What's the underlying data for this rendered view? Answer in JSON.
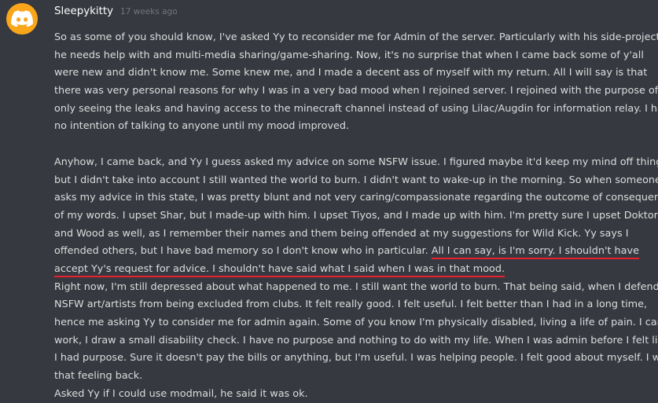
{
  "message": {
    "username": "Sleepykitty",
    "timestamp": "17 weeks ago",
    "avatar": {
      "icon": "discord-logo-icon",
      "background": "#faa61a"
    },
    "paragraphs": [
      {
        "lines": [
          "So as some of you should know, I've asked Yy to reconsider me for Admin of the server. Particularly with his side-projects",
          "he needs help with and multi-media sharing/game-sharing. Now, it's no surprise that when I came back some of y'all",
          "were new and didn't know me. Some knew me, and I made a decent ass of myself with my return. All I will say is that",
          "there was very personal reasons for why I was in a very bad mood when I rejoined server. I rejoined with the purpose of",
          "only seeing the leaks and having access to the minecraft channel instead of using Lilac/Augdin for information relay. I had",
          "no intention of talking to anyone until my mood improved."
        ]
      },
      {
        "lines": [
          "Anyhow, I came back, and Yy I guess asked my advice on some NSFW issue. I figured maybe it'd keep my mind off things,",
          "but I didn't take into account I still wanted the world to burn. I didn't want to wake-up in the morning. So when someone",
          "asks my advice in this state, I was pretty blunt and not very caring/compassionate regarding the outcome of consequence",
          "of my words. I upset Shar, but I made-up with him. I upset Tiyos, and I made up with him. I'm pretty sure I upset Doktor",
          "and Wood as well, as I remember their names and them being offended at my suggestions for Wild Kick. Yy says I"
        ],
        "highlight_lead": "offended others, but I have bad memory so I don't know who in particular. ",
        "highlight_1": "All I can say, is I'm sorry. I shouldn't have",
        "highlight_2": "accept Yy's request for advice. I shouldn't have said what I said when I was in that mood."
      },
      {
        "lines": [
          "Right now, I'm still depressed about what happened to me. I still want the world to burn. That being said, when I defended",
          "NSFW art/artists from being excluded from clubs. It felt really good. I felt useful. I felt better than I had in a long time,",
          "hence me asking Yy to consider me for admin again. Some of you know I'm physically disabled, living a life of pain. I can't",
          "work, I draw a small disability check. I have no purpose and nothing to do with my life. When I was admin before I felt like",
          "I had purpose. Sure it doesn't pay the bills or anything, but I'm useful. I was helping people. I felt good about myself. I want",
          "that feeling back."
        ]
      },
      {
        "lines": [
          "Asked Yy if I could use modmail, he said it was ok."
        ]
      }
    ],
    "colors": {
      "background": "#36393f",
      "text": "#dcddde",
      "username": "#ffffff",
      "timestamp": "#72767d",
      "underline": "#e8202f"
    }
  }
}
